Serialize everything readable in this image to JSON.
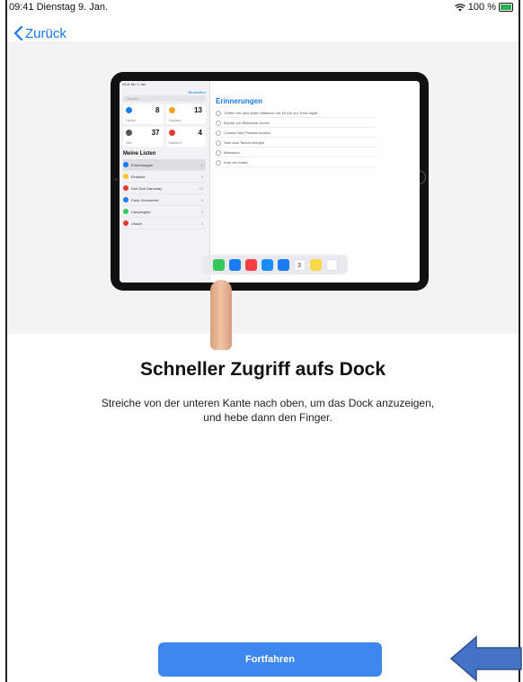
{
  "status_bar": {
    "time_date": "09:41  Dienstag 9. Jan.",
    "battery_percent": "100 %"
  },
  "nav": {
    "back_label": "Zurück"
  },
  "illustration": {
    "device_status_left": "09:41  Mo. 9. Jan.",
    "edit_label": "Bearbeiten",
    "search_placeholder": "Suchen",
    "tiles": [
      {
        "label": "Heute",
        "count": "8",
        "color": "#1a7cf5"
      },
      {
        "label": "Geplant",
        "count": "13",
        "color": "#f7a325"
      },
      {
        "label": "Alle",
        "count": "37",
        "color": "#555555"
      },
      {
        "label": "Markiert",
        "count": "4",
        "color": "#e53b30"
      }
    ],
    "lists_heading": "Meine Listen",
    "lists": [
      {
        "label": "Erinnerungen",
        "count": "6",
        "color": "#1a7cf5",
        "selected": true
      },
      {
        "label": "Einkäufe",
        "count": "5",
        "color": "#f7c325",
        "selected": false
      },
      {
        "label": "Dub Dub Gameday",
        "count": "10",
        "color": "#e53b30",
        "selected": false
      },
      {
        "label": "Party Geschenke",
        "count": "5",
        "color": "#1a7cf5",
        "selected": false
      },
      {
        "label": "Campingtrip",
        "count": "3",
        "color": "#34c759",
        "selected": false
      },
      {
        "label": "Urlaub",
        "count": "3",
        "color": "#e53b30",
        "selected": false
      }
    ],
    "main_title": "Erinnerungen",
    "reminders": [
      "Treffen mit Jane jeden Mittwoch um 18 Uhr zur Trivia Night",
      "Bücher zur Bibliothek zurück",
      "Cookies fürs Picknick backen",
      "Sam zum Tanzen bringen",
      "Malerkurs",
      "Knie mit Kristin"
    ],
    "dock_apps": [
      {
        "icon": "messages-icon",
        "color": "#34c759"
      },
      {
        "icon": "safari-icon",
        "color": "#1a7cf5"
      },
      {
        "icon": "music-icon",
        "color": "#fc3c44"
      },
      {
        "icon": "mail-icon",
        "color": "#1a8cff"
      },
      {
        "icon": "files-icon",
        "color": "#1a7cf5"
      },
      {
        "icon": "calendar-icon",
        "color": "#ffffff"
      },
      {
        "icon": "notes-icon",
        "color": "#f9d94a"
      },
      {
        "icon": "reminders-icon",
        "color": "#ffffff"
      }
    ],
    "calendar_day": "3"
  },
  "content": {
    "heading": "Schneller Zugriff aufs Dock",
    "description_line1": "Streiche von der unteren Kante nach oben, um das Dock anzuzeigen,",
    "description_line2": "und hebe dann den Finger."
  },
  "actions": {
    "continue_label": "Fortfahren"
  },
  "colors": {
    "accent": "#1677ee",
    "button": "#3d87ee",
    "annotation_arrow": "#4472c4"
  }
}
